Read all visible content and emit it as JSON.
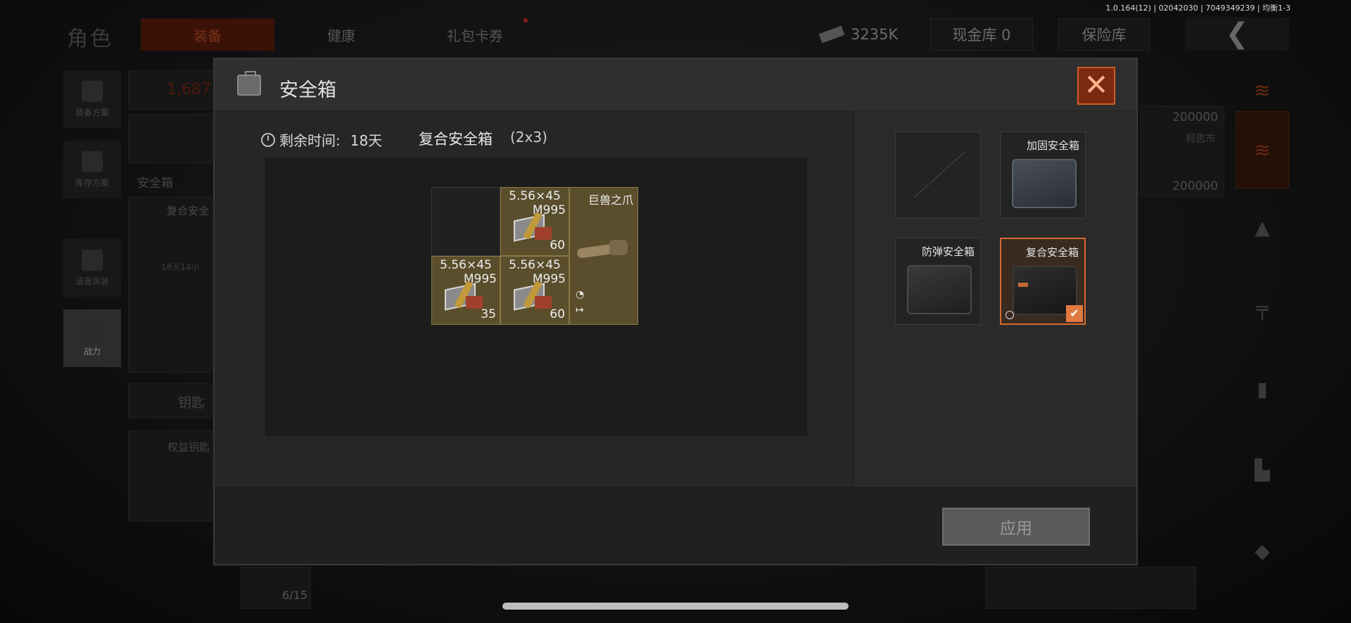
{
  "version": "1.0.164(12) | 02042030 | 7049349239 | 均衡1-3",
  "background": {
    "role_title": "角色",
    "tabs": [
      "装备",
      "健康",
      "礼包卡券"
    ],
    "money": "3235K",
    "cash_vault": "现金库 0",
    "insurance": "保险库",
    "side_items": [
      "装备方案",
      "库存方案",
      "语音涂装",
      "战力"
    ],
    "panel_number": "1,687",
    "safebox_header": "安全箱",
    "safebox_item": "复合安全",
    "safebox_timer": "18天14小",
    "key_header": "钥匙",
    "key_item": "权益钥匙",
    "key_count": "6/15",
    "price_1": "200000",
    "market": "柯思市",
    "price_2": "200000"
  },
  "modal": {
    "title": "安全箱",
    "remaining_label": "剩余时间:",
    "remaining_value": "18天",
    "box_name": "复合安全箱",
    "box_size": "(2x3)",
    "items": [
      {
        "caliber": "5.56×45",
        "variant": "M995",
        "count": "60"
      },
      {
        "caliber": "5.56×45",
        "variant": "M995",
        "count": "35"
      },
      {
        "caliber": "5.56×45",
        "variant": "M995",
        "count": "60"
      }
    ],
    "special_item": "巨兽之爪",
    "options": [
      {
        "name": ""
      },
      {
        "name": "加固安全箱"
      },
      {
        "name": "防弹安全箱"
      },
      {
        "name": "复合安全箱"
      }
    ],
    "apply_label": "应用",
    "close_symbol": "✕",
    "check_symbol": "✔"
  },
  "colors": {
    "accent": "#d86a30",
    "item_bg": "#5a4e2c"
  }
}
